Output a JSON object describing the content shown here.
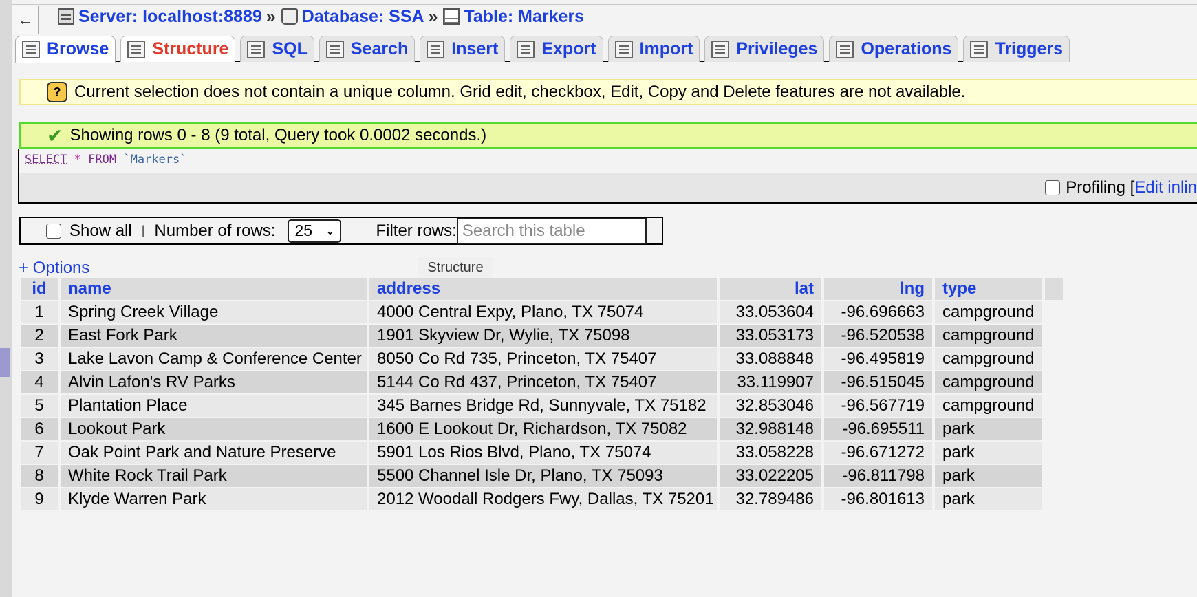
{
  "nav": {
    "back_symbol": "←"
  },
  "breadcrumb": {
    "server": "Server: localhost:8889",
    "sep1": "»",
    "database": "Database: SSA",
    "sep2": "»",
    "table": "Table: Markers"
  },
  "tabs": [
    {
      "label": "Browse",
      "icon": "browse-icon"
    },
    {
      "label": "Structure",
      "icon": "structure-icon"
    },
    {
      "label": "SQL",
      "icon": "sql-icon"
    },
    {
      "label": "Search",
      "icon": "search-icon"
    },
    {
      "label": "Insert",
      "icon": "insert-icon"
    },
    {
      "label": "Export",
      "icon": "export-icon"
    },
    {
      "label": "Import",
      "icon": "import-icon"
    },
    {
      "label": "Privileges",
      "icon": "privileges-icon"
    },
    {
      "label": "Operations",
      "icon": "operations-icon"
    },
    {
      "label": "Triggers",
      "icon": "triggers-icon"
    }
  ],
  "notice": {
    "icon": "?",
    "text": "Current selection does not contain a unique column. Grid edit, checkbox, Edit, Copy and Delete features are not available."
  },
  "success": {
    "icon": "✔",
    "text": "Showing rows 0 - 8 (9 total, Query took 0.0002 seconds.)"
  },
  "sql": {
    "select": "SELECT",
    "star": "*",
    "from": "FROM",
    "table": "`Markers`"
  },
  "profiling": {
    "label": "Profiling",
    "bracket": "[",
    "edit_inline": "Edit inlin"
  },
  "controls": {
    "show_all": "Show all",
    "pipe": "|",
    "number_of_rows_label": "Number of rows:",
    "number_of_rows_value": "25",
    "filter_label": "Filter rows:",
    "filter_placeholder": "Search this table"
  },
  "options_link": "+ Options",
  "tooltip": "Structure",
  "table": {
    "columns": [
      "id",
      "name",
      "address",
      "lat",
      "lng",
      "type"
    ],
    "rows": [
      [
        "1",
        "Spring Creek Village",
        "4000 Central Expy, Plano, TX 75074",
        "33.053604",
        "-96.696663",
        "campground"
      ],
      [
        "2",
        "East Fork Park",
        "1901 Skyview Dr, Wylie, TX 75098",
        "33.053173",
        "-96.520538",
        "campground"
      ],
      [
        "3",
        "Lake Lavon Camp & Conference Center",
        "8050 Co Rd 735, Princeton, TX 75407",
        "33.088848",
        "-96.495819",
        "campground"
      ],
      [
        "4",
        "Alvin Lafon's RV Parks",
        "5144 Co Rd 437, Princeton, TX 75407",
        "33.119907",
        "-96.515045",
        "campground"
      ],
      [
        "5",
        "Plantation Place",
        "345 Barnes Bridge Rd, Sunnyvale, TX 75182",
        "32.853046",
        "-96.567719",
        "campground"
      ],
      [
        "6",
        "Lookout Park",
        "1600 E Lookout Dr, Richardson, TX 75082",
        "32.988148",
        "-96.695511",
        "park"
      ],
      [
        "7",
        "Oak Point Park and Nature Preserve",
        "5901 Los Rios Blvd, Plano, TX 75074",
        "33.058228",
        "-96.671272",
        "park"
      ],
      [
        "8",
        "White Rock Trail Park",
        "5500 Channel Isle Dr, Plano, TX 75093",
        "33.022205",
        "-96.811798",
        "park"
      ],
      [
        "9",
        "Klyde Warren Park",
        "2012 Woodall Rodgers Fwy, Dallas, TX 75201",
        "32.789486",
        "-96.801613",
        "park"
      ]
    ]
  }
}
